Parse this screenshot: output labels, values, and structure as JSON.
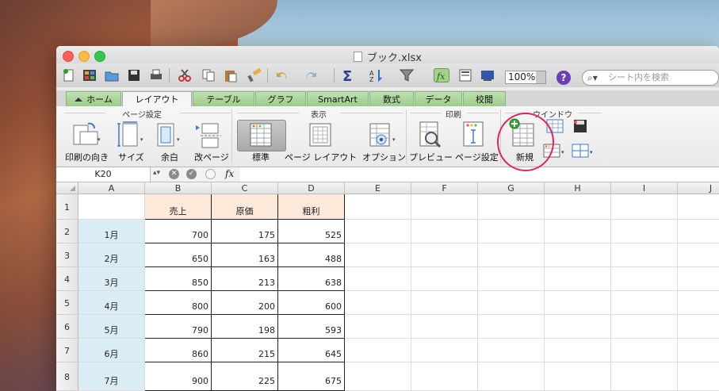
{
  "window": {
    "title": "ブック.xlsx"
  },
  "toolbar": {
    "zoom": "100%",
    "search_placeholder": "シート内を検索"
  },
  "tabs": [
    {
      "label": "ホーム"
    },
    {
      "label": "レイアウト"
    },
    {
      "label": "テーブル"
    },
    {
      "label": "グラフ"
    },
    {
      "label": "SmartArt"
    },
    {
      "label": "数式"
    },
    {
      "label": "データ"
    },
    {
      "label": "校閲"
    }
  ],
  "ribbon": {
    "groups": {
      "page_setup": "ページ設定",
      "view": "表示",
      "print": "印刷",
      "window": "ウインドウ"
    },
    "buttons": {
      "orientation": "印刷の向き",
      "size": "サイズ",
      "margins": "余白",
      "breaks": "改ページ",
      "normal": "標準",
      "page_layout": "ページ レイアウト",
      "options": "オプション",
      "preview": "プレビュー",
      "page_setup": "ページ設定",
      "new_window": "新規"
    }
  },
  "formula_bar": {
    "cell_ref": "K20",
    "fx": "fx"
  },
  "sheet": {
    "columns": [
      "A",
      "B",
      "C",
      "D",
      "E",
      "F",
      "G",
      "H",
      "I",
      "J"
    ],
    "rows": [
      "1",
      "2",
      "3",
      "4",
      "5",
      "6",
      "7",
      "8"
    ],
    "headers": [
      "売上",
      "原価",
      "粗利"
    ],
    "data": [
      {
        "month": "1月",
        "sales": "700",
        "cost": "175",
        "profit": "525"
      },
      {
        "month": "2月",
        "sales": "650",
        "cost": "163",
        "profit": "488"
      },
      {
        "month": "3月",
        "sales": "850",
        "cost": "213",
        "profit": "638"
      },
      {
        "month": "4月",
        "sales": "800",
        "cost": "200",
        "profit": "600"
      },
      {
        "month": "5月",
        "sales": "790",
        "cost": "198",
        "profit": "593"
      },
      {
        "month": "6月",
        "sales": "860",
        "cost": "215",
        "profit": "645"
      },
      {
        "month": "7月",
        "sales": "900",
        "cost": "225",
        "profit": "675"
      }
    ]
  },
  "colors": {
    "tab_green": "#9ccb8b",
    "month_fill": "#daedf4",
    "header_fill": "#fde9d9",
    "ring": "#e0245e"
  }
}
